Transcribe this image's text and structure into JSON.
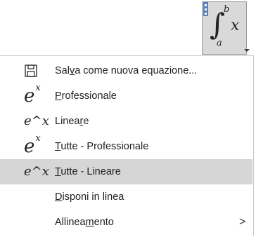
{
  "equation": {
    "upper_limit": "b",
    "lower_limit": "a",
    "integral_symbol": "∫",
    "variable": "x"
  },
  "menu": {
    "items": [
      {
        "pre": "Sal",
        "u": "v",
        "post": "a come nuova equazione...",
        "icon": "save-icon"
      },
      {
        "pre": "",
        "u": "P",
        "post": "rofessionale",
        "icon": "professional-format-icon"
      },
      {
        "pre": "Linea",
        "u": "r",
        "post": "e",
        "icon": "linear-format-icon"
      },
      {
        "pre": "",
        "u": "T",
        "post": "utte - Professionale",
        "icon": "professional-format-icon"
      },
      {
        "pre": "",
        "u": "T",
        "post": "utte - Lineare",
        "icon": "linear-format-icon"
      },
      {
        "pre": "",
        "u": "D",
        "post": "isponi in linea",
        "icon": ""
      },
      {
        "pre": "Allinea",
        "u": "m",
        "post": "ento",
        "icon": "",
        "submenu": ">"
      }
    ],
    "highlighted_index": 4
  },
  "icons": {
    "professional_base": "e",
    "professional_exp": "x",
    "linear_text": "e^x"
  }
}
